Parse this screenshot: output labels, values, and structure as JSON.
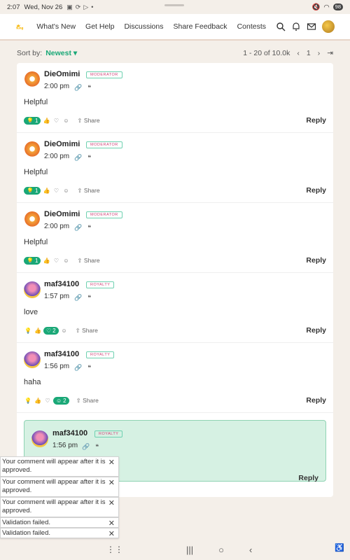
{
  "status": {
    "time": "2:07",
    "date": "Wed, Nov 26",
    "battery": "98"
  },
  "nav": {
    "links": [
      "What's New",
      "Get Help",
      "Discussions",
      "Share Feedback",
      "Contests"
    ]
  },
  "sort": {
    "label": "Sort by:",
    "value": "Newest",
    "range": "1 - 20 of 10.0k",
    "page": "1"
  },
  "comments": [
    {
      "name": "DieOmimi",
      "badge": "MODERATOR",
      "time": "2:00 pm",
      "body": "Helpful",
      "count": "1",
      "share": "Share",
      "reply": "Reply"
    },
    {
      "name": "DieOmimi",
      "badge": "MODERATOR",
      "time": "2:00 pm",
      "body": "Helpful",
      "count": "1",
      "share": "Share",
      "reply": "Reply"
    },
    {
      "name": "DieOmimi",
      "badge": "MODERATOR",
      "time": "2:00 pm",
      "body": "Helpful",
      "count": "1",
      "share": "Share",
      "reply": "Reply"
    },
    {
      "name": "maf34100",
      "badge": "ROYALTY",
      "time": "1:57 pm",
      "body": "love",
      "count": "2",
      "share": "Share",
      "reply": "Reply"
    },
    {
      "name": "maf34100",
      "badge": "ROYALTY",
      "time": "1:56 pm",
      "body": "haha",
      "count": "2",
      "share": "Share",
      "reply": "Reply"
    }
  ],
  "pending": {
    "name": "maf34100",
    "badge": "ROYALTY",
    "time": "1:56 pm",
    "reply": "Reply"
  },
  "toasts": [
    "Your comment will appear after it is approved.",
    "Your comment will appear after it is approved.",
    "Your comment will appear after it is approved.",
    "Validation failed.",
    "Validation failed."
  ]
}
